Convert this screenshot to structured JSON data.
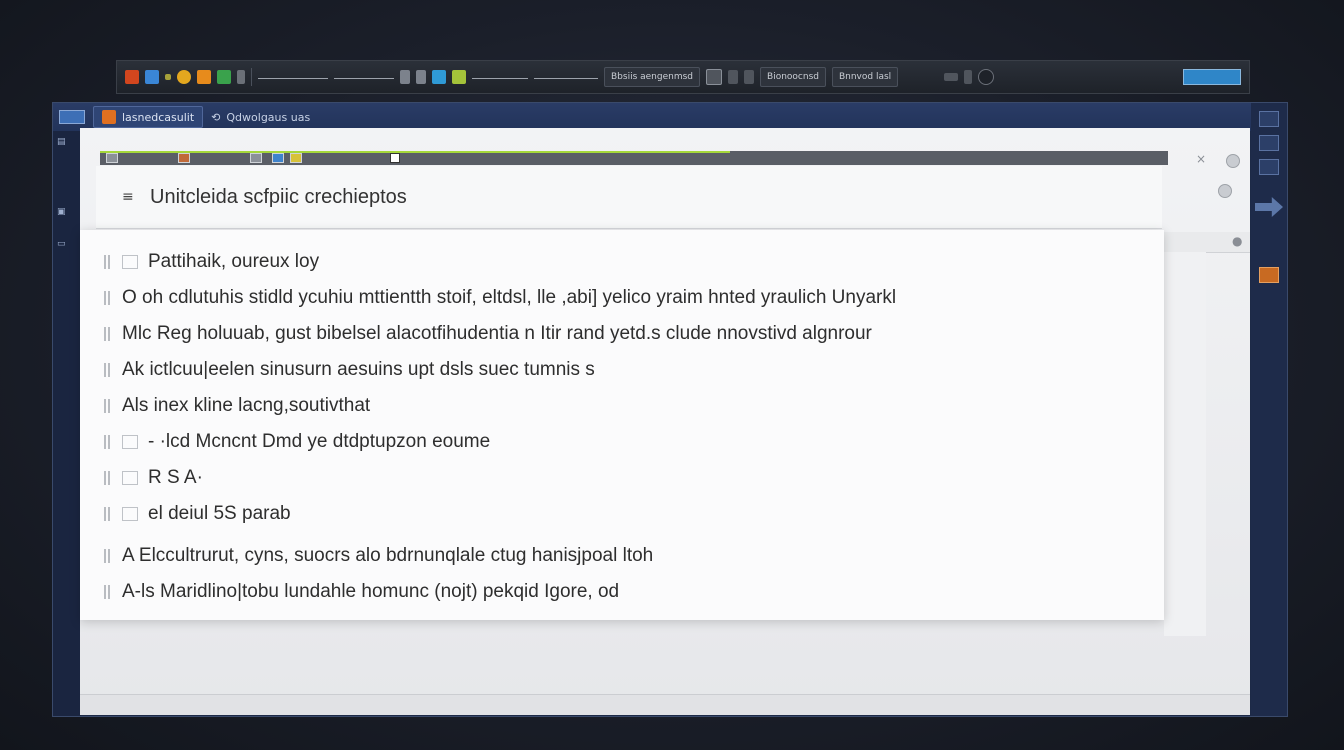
{
  "taskbar": {
    "buttons": [
      {
        "label": "Bbsiis aengenmsd"
      },
      {
        "label": "Bionoocnsd"
      },
      {
        "label": "Bnnvod lasl"
      }
    ]
  },
  "window": {
    "tab_active": "lasnedcasulit",
    "tab_secondary": "Qdwolgaus uas"
  },
  "document": {
    "title": "Unitcleida scfpiic crechieptos",
    "items": [
      "Pattihaik, oureux loy",
      "O oh cdlutuhis stidld ycuhiu mttientth stoif, eltdsl, lle ,abi] yelico yraim hnted yraulich Unyarkl",
      "Mlc Reg holuuab, gust bibelsel alacotfihudentia n Itir rand yetd.s clude nnovstivd algnrour",
      "Ak ictlcuu|eelen sinusurn aesuins upt dsls suec tumnis s",
      "Als inex kline lacng,soutivthat",
      "- ·lcd Mcncnt Dmd ye dtdptupzon eoume",
      "R S A·",
      "el deiul 5S parab",
      "A Elccultrurut, cyns, suocrs alo bdrnunqlale ctug hanisjpoal ltoh",
      "A-ls Maridlino|tobu lundahle homunc (nojt) pekqid Igore, od"
    ]
  },
  "progress": {
    "fraction": 0.59
  },
  "colors": {
    "accent_green": "#a5d83a",
    "app_orange": "#e07020",
    "title_blue": "#22335a"
  }
}
